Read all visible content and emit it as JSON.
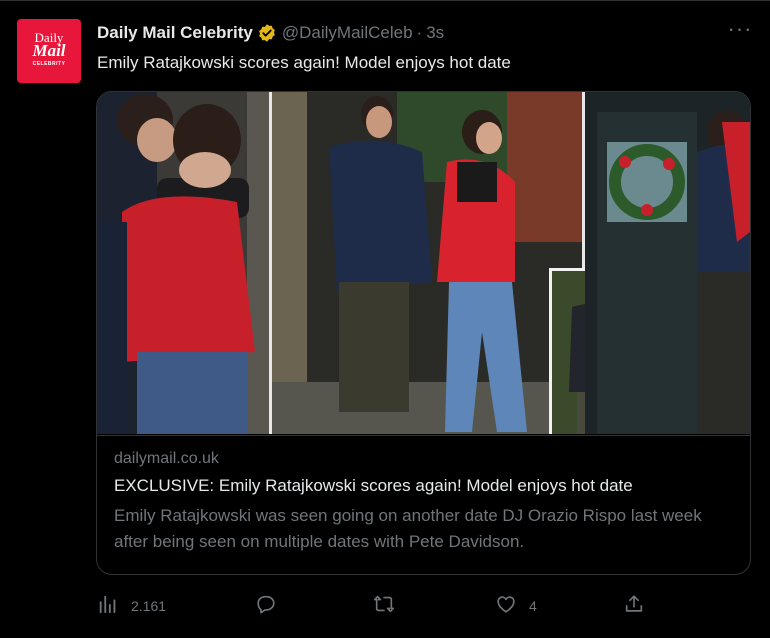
{
  "tweet": {
    "avatar": {
      "line1": "Daily",
      "line2": "Mail",
      "line3": "CELEBRITY",
      "color": "#e8163b"
    },
    "display_name": "Daily Mail Celebrity",
    "verified_icon": "gold-verified-badge",
    "handle": "@DailyMailCeleb",
    "separator": "·",
    "time": "3s",
    "more_icon": "more-horizontal-icon",
    "more_label": "···",
    "text": "Emily Ratajkowski scores again! Model enjoys hot date"
  },
  "card": {
    "image_description_icon": "news-photo-collage",
    "domain": "dailymail.co.uk",
    "title": "EXCLUSIVE: Emily Ratajkowski scores again! Model enjoys hot date",
    "description": "Emily Ratajkowski was seen going on another date DJ Orazio Rispo last week after being seen on multiple dates with Pete Davidson."
  },
  "actions": {
    "views": {
      "icon": "bar-chart-icon",
      "count": "2.161"
    },
    "reply": {
      "icon": "reply-bubble-icon",
      "count": ""
    },
    "retweet": {
      "icon": "retweet-icon",
      "count": ""
    },
    "like": {
      "icon": "heart-icon",
      "count": "4"
    },
    "share": {
      "icon": "share-upload-icon",
      "count": ""
    }
  },
  "colors": {
    "background": "#000000",
    "primary_text": "#e7e9ea",
    "secondary_text": "#71767b",
    "border": "#2f3336",
    "verified_gold": "#e2b719"
  }
}
